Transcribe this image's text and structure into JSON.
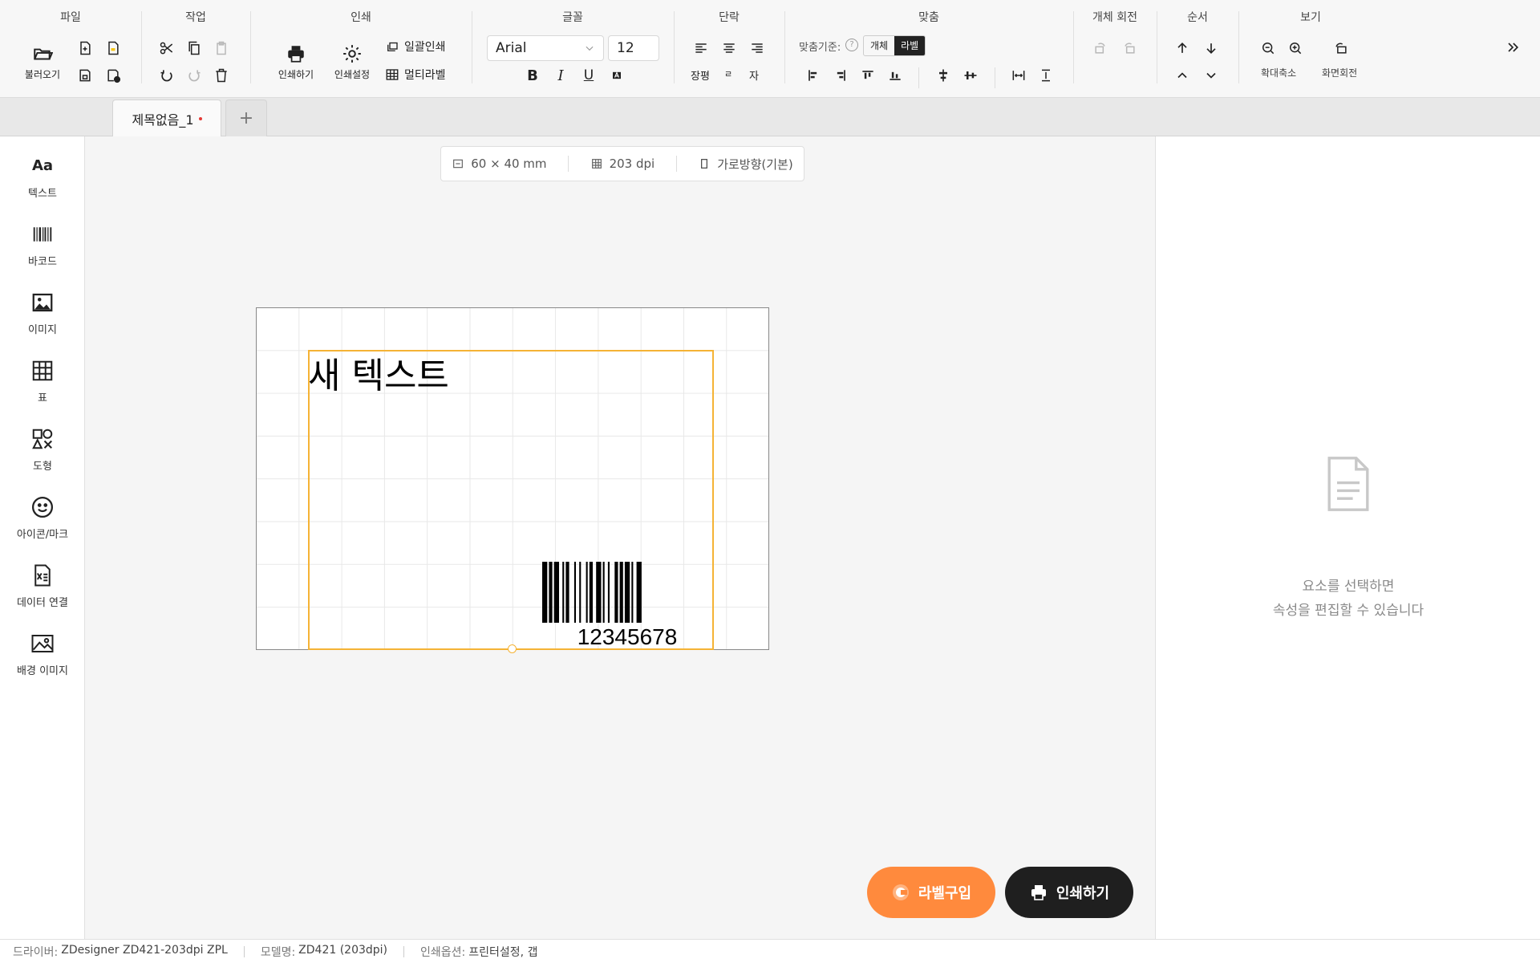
{
  "toolbar": {
    "groups": {
      "file": "파일",
      "edit": "작업",
      "print": "인쇄",
      "font": "글꼴",
      "paragraph": "단락",
      "align": "맞춤",
      "rotate": "개체 회전",
      "order": "순서",
      "view": "보기"
    },
    "file": {
      "open_label": "불러오기"
    },
    "print": {
      "print_label": "인쇄하기",
      "settings_label": "인쇄설정",
      "batch_label": "일괄인쇄",
      "multi_label": "멀티라벨"
    },
    "font": {
      "family": "Arial",
      "size": "12"
    },
    "paragraph": {
      "justify_label": "장평",
      "spacing_label": "ㄹ",
      "char_label": "자"
    },
    "align": {
      "basis_label": "맞춤기준:",
      "opt_object": "개체",
      "opt_label": "라벨",
      "selected": "라벨"
    },
    "view": {
      "zoom_label": "확대축소",
      "rotate_label": "화면회전"
    }
  },
  "tabs": [
    {
      "title": "제목없음_1",
      "modified": true
    }
  ],
  "add_tab": "+",
  "sidebar": {
    "items": [
      {
        "label": "텍스트",
        "icon": "text-icon",
        "glyph": "Aa"
      },
      {
        "label": "바코드",
        "icon": "barcode-icon"
      },
      {
        "label": "이미지",
        "icon": "image-icon"
      },
      {
        "label": "표",
        "icon": "table-icon"
      },
      {
        "label": "도형",
        "icon": "shapes-icon"
      },
      {
        "label": "아이콘/마크",
        "icon": "smiley-icon"
      },
      {
        "label": "데이터 연결",
        "icon": "excel-file-icon"
      },
      {
        "label": "배경 이미지",
        "icon": "background-image-icon"
      }
    ]
  },
  "canvas": {
    "size": "60 × 40 mm",
    "dpi": "203 dpi",
    "orientation": "가로방향(기본)",
    "label_text": "새 텍스트",
    "barcode_value": "12345678"
  },
  "actions": {
    "buy_label": "라벨구입",
    "print_label": "인쇄하기"
  },
  "rightpanel": {
    "line1": "요소를 선택하면",
    "line2": "속성을 편집할 수 있습니다"
  },
  "status": {
    "driver_key": "드라이버:",
    "driver_val": "ZDesigner ZD421-203dpi ZPL",
    "model_key": "모델명:",
    "model_val": "ZD421 (203dpi)",
    "opt_key": "인쇄옵션:",
    "opt_val": "프린터설정, 갭"
  },
  "colors": {
    "accent_orange": "#ff8a3d",
    "selection": "#f5b335",
    "dark_button": "#1f1f1f",
    "modified_dot": "#e53935"
  }
}
